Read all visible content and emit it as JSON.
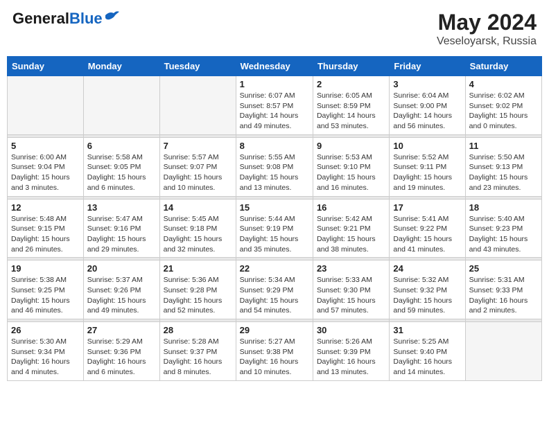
{
  "header": {
    "logo_line1": "General",
    "logo_line2": "Blue",
    "month_year": "May 2024",
    "location": "Veseloyarsk, Russia"
  },
  "days_of_week": [
    "Sunday",
    "Monday",
    "Tuesday",
    "Wednesday",
    "Thursday",
    "Friday",
    "Saturday"
  ],
  "weeks": [
    {
      "days": [
        {
          "num": "",
          "info": ""
        },
        {
          "num": "",
          "info": ""
        },
        {
          "num": "",
          "info": ""
        },
        {
          "num": "1",
          "info": "Sunrise: 6:07 AM\nSunset: 8:57 PM\nDaylight: 14 hours\nand 49 minutes."
        },
        {
          "num": "2",
          "info": "Sunrise: 6:05 AM\nSunset: 8:59 PM\nDaylight: 14 hours\nand 53 minutes."
        },
        {
          "num": "3",
          "info": "Sunrise: 6:04 AM\nSunset: 9:00 PM\nDaylight: 14 hours\nand 56 minutes."
        },
        {
          "num": "4",
          "info": "Sunrise: 6:02 AM\nSunset: 9:02 PM\nDaylight: 15 hours\nand 0 minutes."
        }
      ]
    },
    {
      "days": [
        {
          "num": "5",
          "info": "Sunrise: 6:00 AM\nSunset: 9:04 PM\nDaylight: 15 hours\nand 3 minutes."
        },
        {
          "num": "6",
          "info": "Sunrise: 5:58 AM\nSunset: 9:05 PM\nDaylight: 15 hours\nand 6 minutes."
        },
        {
          "num": "7",
          "info": "Sunrise: 5:57 AM\nSunset: 9:07 PM\nDaylight: 15 hours\nand 10 minutes."
        },
        {
          "num": "8",
          "info": "Sunrise: 5:55 AM\nSunset: 9:08 PM\nDaylight: 15 hours\nand 13 minutes."
        },
        {
          "num": "9",
          "info": "Sunrise: 5:53 AM\nSunset: 9:10 PM\nDaylight: 15 hours\nand 16 minutes."
        },
        {
          "num": "10",
          "info": "Sunrise: 5:52 AM\nSunset: 9:11 PM\nDaylight: 15 hours\nand 19 minutes."
        },
        {
          "num": "11",
          "info": "Sunrise: 5:50 AM\nSunset: 9:13 PM\nDaylight: 15 hours\nand 23 minutes."
        }
      ]
    },
    {
      "days": [
        {
          "num": "12",
          "info": "Sunrise: 5:48 AM\nSunset: 9:15 PM\nDaylight: 15 hours\nand 26 minutes."
        },
        {
          "num": "13",
          "info": "Sunrise: 5:47 AM\nSunset: 9:16 PM\nDaylight: 15 hours\nand 29 minutes."
        },
        {
          "num": "14",
          "info": "Sunrise: 5:45 AM\nSunset: 9:18 PM\nDaylight: 15 hours\nand 32 minutes."
        },
        {
          "num": "15",
          "info": "Sunrise: 5:44 AM\nSunset: 9:19 PM\nDaylight: 15 hours\nand 35 minutes."
        },
        {
          "num": "16",
          "info": "Sunrise: 5:42 AM\nSunset: 9:21 PM\nDaylight: 15 hours\nand 38 minutes."
        },
        {
          "num": "17",
          "info": "Sunrise: 5:41 AM\nSunset: 9:22 PM\nDaylight: 15 hours\nand 41 minutes."
        },
        {
          "num": "18",
          "info": "Sunrise: 5:40 AM\nSunset: 9:23 PM\nDaylight: 15 hours\nand 43 minutes."
        }
      ]
    },
    {
      "days": [
        {
          "num": "19",
          "info": "Sunrise: 5:38 AM\nSunset: 9:25 PM\nDaylight: 15 hours\nand 46 minutes."
        },
        {
          "num": "20",
          "info": "Sunrise: 5:37 AM\nSunset: 9:26 PM\nDaylight: 15 hours\nand 49 minutes."
        },
        {
          "num": "21",
          "info": "Sunrise: 5:36 AM\nSunset: 9:28 PM\nDaylight: 15 hours\nand 52 minutes."
        },
        {
          "num": "22",
          "info": "Sunrise: 5:34 AM\nSunset: 9:29 PM\nDaylight: 15 hours\nand 54 minutes."
        },
        {
          "num": "23",
          "info": "Sunrise: 5:33 AM\nSunset: 9:30 PM\nDaylight: 15 hours\nand 57 minutes."
        },
        {
          "num": "24",
          "info": "Sunrise: 5:32 AM\nSunset: 9:32 PM\nDaylight: 15 hours\nand 59 minutes."
        },
        {
          "num": "25",
          "info": "Sunrise: 5:31 AM\nSunset: 9:33 PM\nDaylight: 16 hours\nand 2 minutes."
        }
      ]
    },
    {
      "days": [
        {
          "num": "26",
          "info": "Sunrise: 5:30 AM\nSunset: 9:34 PM\nDaylight: 16 hours\nand 4 minutes."
        },
        {
          "num": "27",
          "info": "Sunrise: 5:29 AM\nSunset: 9:36 PM\nDaylight: 16 hours\nand 6 minutes."
        },
        {
          "num": "28",
          "info": "Sunrise: 5:28 AM\nSunset: 9:37 PM\nDaylight: 16 hours\nand 8 minutes."
        },
        {
          "num": "29",
          "info": "Sunrise: 5:27 AM\nSunset: 9:38 PM\nDaylight: 16 hours\nand 10 minutes."
        },
        {
          "num": "30",
          "info": "Sunrise: 5:26 AM\nSunset: 9:39 PM\nDaylight: 16 hours\nand 13 minutes."
        },
        {
          "num": "31",
          "info": "Sunrise: 5:25 AM\nSunset: 9:40 PM\nDaylight: 16 hours\nand 14 minutes."
        },
        {
          "num": "",
          "info": ""
        }
      ]
    }
  ]
}
